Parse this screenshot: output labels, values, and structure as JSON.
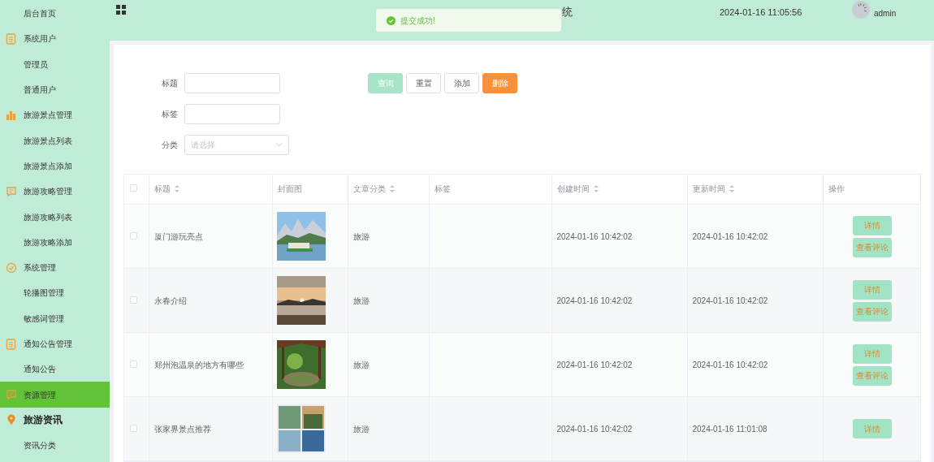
{
  "sidebar": {
    "items": [
      {
        "kind": "item",
        "label": "后台首页",
        "selected": false
      },
      {
        "kind": "group",
        "label": "系统用户",
        "expanded": false,
        "selected": false
      },
      {
        "kind": "item",
        "label": "管理员",
        "selected": false
      },
      {
        "kind": "item",
        "label": "普通用户",
        "selected": false
      },
      {
        "kind": "group",
        "label": "旅游景点管理",
        "expanded": false,
        "selected": false
      },
      {
        "kind": "item",
        "label": "旅游景点列表",
        "selected": false
      },
      {
        "kind": "item",
        "label": "旅游景点添加",
        "selected": false
      },
      {
        "kind": "group",
        "label": "旅游攻略管理",
        "expanded": false,
        "selected": false
      },
      {
        "kind": "item",
        "label": "旅游攻略列表",
        "selected": false
      },
      {
        "kind": "item",
        "label": "旅游攻略添加",
        "selected": false
      },
      {
        "kind": "group",
        "label": "系统管理",
        "expanded": false,
        "selected": false
      },
      {
        "kind": "item",
        "label": "轮播图管理",
        "selected": false
      },
      {
        "kind": "item",
        "label": "敏感词管理",
        "selected": false
      },
      {
        "kind": "group",
        "label": "通知公告管理",
        "expanded": false,
        "selected": false
      },
      {
        "kind": "item",
        "label": "通知公告",
        "selected": false
      },
      {
        "kind": "group",
        "label": "资源管理",
        "expanded": false,
        "selected": true
      },
      {
        "kind": "group",
        "label": "旅游资讯",
        "expanded": true,
        "selected": false
      },
      {
        "kind": "item",
        "label": "资讯分类",
        "selected": false
      }
    ]
  },
  "header": {
    "title": "统",
    "datetime": "2024-01-16 11:05:56",
    "user": "admin"
  },
  "toast": {
    "kind": "success",
    "message": "提交成功!"
  },
  "filters": [
    {
      "kind": "input",
      "label": "标题"
    },
    {
      "kind": "input",
      "label": "标签"
    },
    {
      "kind": "select",
      "label": "分类",
      "placeholder": "请选择"
    }
  ],
  "actions": [
    {
      "kind": "primary",
      "label": "查询"
    },
    {
      "kind": "plain",
      "label": "重置"
    },
    {
      "kind": "plain",
      "label": "添加"
    },
    {
      "kind": "danger",
      "label": "删除"
    }
  ],
  "table": {
    "select_all": {
      "checked": false
    },
    "columns": [
      {
        "label": "标题",
        "sortable": true
      },
      {
        "label": "封面图",
        "sortable": false
      },
      {
        "label": "文章分类",
        "sortable": true
      },
      {
        "label": "标签",
        "sortable": false
      },
      {
        "label": "创建时间",
        "sortable": true
      },
      {
        "label": "更新时间",
        "sortable": true
      },
      {
        "label": "操作",
        "sortable": false
      }
    ],
    "rows": [
      {
        "checked": false,
        "title": "厦门游玩亮点",
        "cover": {
          "kind": "picture"
        },
        "category": "旅游",
        "created": "2024-01-16 10:42:02",
        "updated": "2024-01-16 10:42:02",
        "actions": [
          "详情",
          "查看评论"
        ]
      },
      {
        "checked": false,
        "title": "永春介绍",
        "cover": {
          "kind": "picture"
        },
        "category": "旅游",
        "created": "2024-01-16 10:42:02",
        "updated": "2024-01-16 10:42:02",
        "actions": [
          "详情",
          "查看评论"
        ]
      },
      {
        "checked": false,
        "title": "郑州泡温泉的地方有哪些",
        "cover": {
          "kind": "picture"
        },
        "category": "旅游",
        "created": "2024-01-16 10:42:02",
        "updated": "2024-01-16 10:42:02",
        "actions": [
          "详情",
          "查看评论"
        ]
      },
      {
        "checked": false,
        "title": "张家界景点推荐",
        "cover": {
          "kind": "picture"
        },
        "category": "旅游",
        "created": "2024-01-16 10:42:02",
        "updated": "2024-01-16 11:01:08",
        "actions": [
          "详情"
        ]
      }
    ]
  }
}
